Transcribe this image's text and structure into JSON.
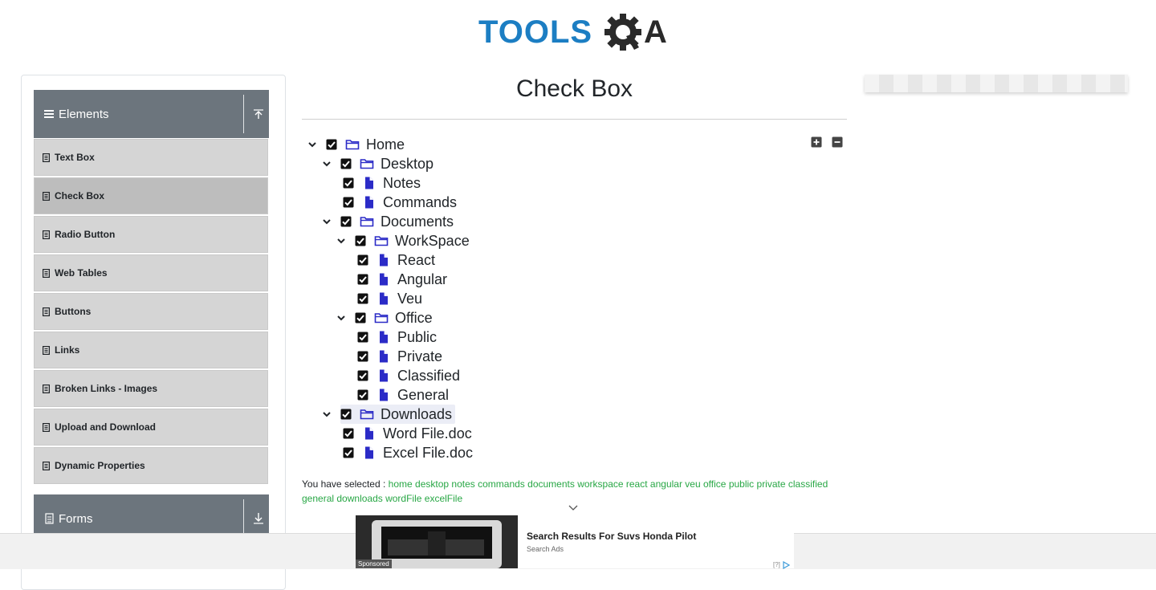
{
  "logo": {
    "text": "TOOLS",
    "text_end": "A",
    "brand_blue": "#1c7ec3",
    "brand_dark": "#2a2a2a"
  },
  "sidebar": {
    "groups": [
      {
        "label": "Elements",
        "arrow": "arrow-up-icon"
      },
      {
        "label": "Forms",
        "arrow": "arrow-down-icon"
      }
    ],
    "items": [
      {
        "label": "Text Box"
      },
      {
        "label": "Check Box",
        "active": true
      },
      {
        "label": "Radio Button"
      },
      {
        "label": "Web Tables"
      },
      {
        "label": "Buttons"
      },
      {
        "label": "Links"
      },
      {
        "label": "Broken Links - Images"
      },
      {
        "label": "Upload and Download"
      },
      {
        "label": "Dynamic Properties"
      }
    ]
  },
  "main": {
    "title": "Check Box",
    "tree": [
      {
        "label": "Home",
        "type": "folder",
        "expanded": true,
        "checked": true,
        "depth": 0
      },
      {
        "label": "Desktop",
        "type": "folder",
        "expanded": true,
        "checked": true,
        "depth": 1
      },
      {
        "label": "Notes",
        "type": "file",
        "checked": true,
        "depth": 2
      },
      {
        "label": "Commands",
        "type": "file",
        "checked": true,
        "depth": 2
      },
      {
        "label": "Documents",
        "type": "folder",
        "expanded": true,
        "checked": true,
        "depth": 1
      },
      {
        "label": "WorkSpace",
        "type": "folder",
        "expanded": true,
        "checked": true,
        "depth": 2
      },
      {
        "label": "React",
        "type": "file",
        "checked": true,
        "depth": 3
      },
      {
        "label": "Angular",
        "type": "file",
        "checked": true,
        "depth": 3
      },
      {
        "label": "Veu",
        "type": "file",
        "checked": true,
        "depth": 3
      },
      {
        "label": "Office",
        "type": "folder",
        "expanded": true,
        "checked": true,
        "depth": 2
      },
      {
        "label": "Public",
        "type": "file",
        "checked": true,
        "depth": 3
      },
      {
        "label": "Private",
        "type": "file",
        "checked": true,
        "depth": 3
      },
      {
        "label": "Classified",
        "type": "file",
        "checked": true,
        "depth": 3
      },
      {
        "label": "General",
        "type": "file",
        "checked": true,
        "depth": 3
      },
      {
        "label": "Downloads",
        "type": "folder",
        "expanded": true,
        "checked": true,
        "depth": 1,
        "highlighted": true
      },
      {
        "label": "Word File.doc",
        "type": "file",
        "checked": true,
        "depth": 2
      },
      {
        "label": "Excel File.doc",
        "type": "file",
        "checked": true,
        "depth": 2
      }
    ],
    "result_prefix": "You have selected :",
    "selected": [
      "home",
      "desktop",
      "notes",
      "commands",
      "documents",
      "workspace",
      "react",
      "angular",
      "veu",
      "office",
      "public",
      "private",
      "classified",
      "general",
      "downloads",
      "wordFile",
      "excelFile"
    ]
  },
  "ad": {
    "title": "Search Results For Suvs Honda Pilot",
    "subtitle": "Search Ads",
    "sponsored": "Sponsored",
    "choices": "[?]"
  },
  "colors": {
    "accent_blue": "#2b2bc7",
    "selected_green": "#28a745",
    "nav_header": "#6c757d"
  }
}
